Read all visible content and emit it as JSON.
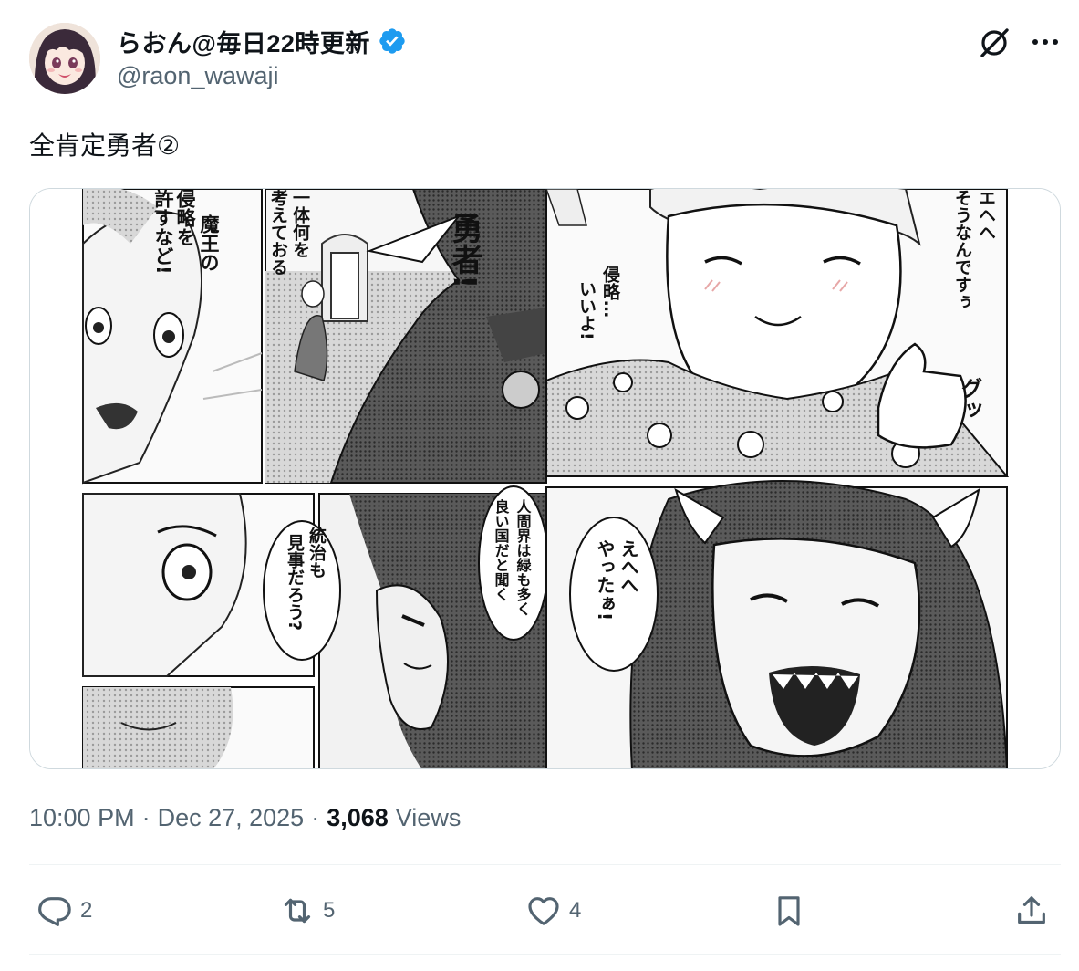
{
  "author": {
    "display_name": "らおん@毎日22時更新",
    "handle": "@raon_wawaji",
    "verified_color": "#1d9bf0"
  },
  "tweet": {
    "text": "全肯定勇者②"
  },
  "manga": {
    "panel1_bubble": [
      "魔王の",
      "侵略を",
      "許すなど!"
    ],
    "panel2_bubble": [
      "一体何を",
      "考えておる"
    ],
    "panel3_shout": "勇者!",
    "panel4_bubble": [
      "エヘヘ",
      "そうなんですぅ"
    ],
    "panel4_side": [
      "侵略…",
      "いいよ!"
    ],
    "panel4_sfx": "グッ",
    "panel6_bubble": [
      "統治も",
      "見事だろう?"
    ],
    "panel7_bubble": [
      "人間界は緑も多く",
      "良い国だと聞く"
    ],
    "panel8_bubble": [
      "えへへ",
      "やったぁ!"
    ]
  },
  "meta": {
    "time": "10:00 PM",
    "sep1": "·",
    "date": "Dec 27, 2025",
    "sep2": "·",
    "views_count": "3,068",
    "views_label": "Views"
  },
  "actions": {
    "replies": "2",
    "reposts": "5",
    "likes": "4"
  },
  "colors": {
    "text_primary": "#0f1419",
    "text_secondary": "#536471",
    "border": "#cfd9de"
  }
}
